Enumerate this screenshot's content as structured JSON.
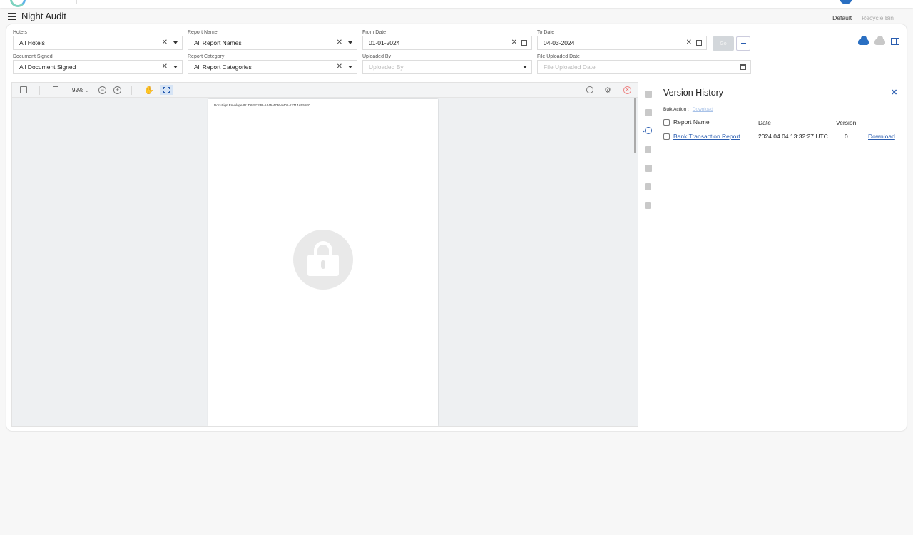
{
  "header": {
    "title": "Night Audit",
    "tabs": [
      {
        "label": "Default",
        "active": true
      },
      {
        "label": "Recycle Bin",
        "active": false
      }
    ]
  },
  "filters": {
    "hotels": {
      "label": "Hotels",
      "value": "All Hotels"
    },
    "report_name": {
      "label": "Report Name",
      "value": "All Report Names"
    },
    "from_date": {
      "label": "From Date",
      "value": "01-01-2024"
    },
    "to_date": {
      "label": "To Date",
      "value": "04-03-2024"
    },
    "document_signed": {
      "label": "Document Signed",
      "value": "All Document Signed"
    },
    "report_category": {
      "label": "Report Category",
      "value": "All Report Categories"
    },
    "uploaded_by": {
      "label": "Uploaded By",
      "placeholder": "Uploaded By"
    },
    "file_uploaded_date": {
      "label": "File Uploaded Date",
      "placeholder": "File Uploaded Date"
    },
    "go_label": "Go"
  },
  "viewer": {
    "zoom": "92%",
    "envelope_text": "DocuSign Envelope ID: D6F8723B-A245-4736-9401-12714AE55F0"
  },
  "version_history": {
    "title": "Version History",
    "bulk_action_label": "Bulk Action :",
    "bulk_download_label": "Download",
    "columns": {
      "report_name": "Report Name",
      "date": "Date",
      "version": "Version"
    },
    "rows": [
      {
        "report_name": "Bank Transaction Report",
        "date": "2024.04.04 13:32:27 UTC",
        "version": "0",
        "action": "Download"
      }
    ]
  },
  "icons": {
    "menu": "hamburger-icon",
    "upload": "cloud-upload-icon",
    "download": "cloud-download-icon",
    "columns": "columns-icon",
    "filter": "filter-icon",
    "lock": "lock-icon"
  },
  "colors": {
    "accent": "#2a5db0",
    "tab_underline": "#f0a020",
    "go_button": "#d3d7db"
  }
}
